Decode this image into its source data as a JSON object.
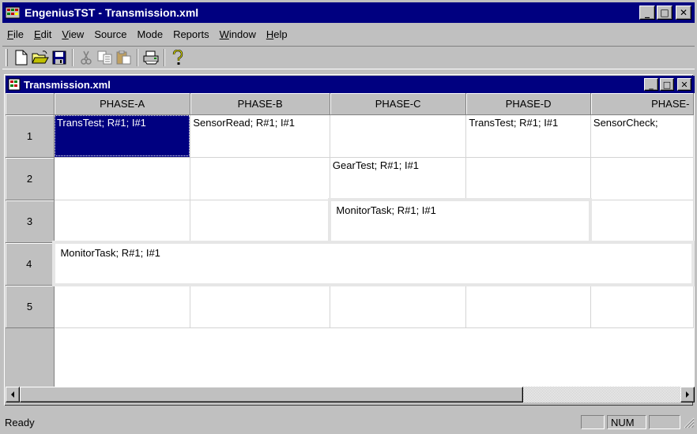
{
  "app": {
    "title": "EngeniusTST - Transmission.xml"
  },
  "menu": [
    {
      "pre": "",
      "key": "F",
      "post": "ile"
    },
    {
      "pre": "",
      "key": "E",
      "post": "dit"
    },
    {
      "pre": "",
      "key": "V",
      "post": "iew"
    },
    {
      "pre": "Source",
      "key": "",
      "post": ""
    },
    {
      "pre": "Mode",
      "key": "",
      "post": ""
    },
    {
      "pre": "Reports",
      "key": "",
      "post": ""
    },
    {
      "pre": "",
      "key": "W",
      "post": "indow"
    },
    {
      "pre": "",
      "key": "H",
      "post": "elp"
    }
  ],
  "window_buttons": {
    "minimize": "_",
    "maximize": "□",
    "close": "✕"
  },
  "document": {
    "title": "Transmission.xml"
  },
  "grid": {
    "columns": [
      "PHASE-A",
      "PHASE-B",
      "PHASE-C",
      "PHASE-D",
      "PHASE-"
    ],
    "rows": [
      {
        "label": "1",
        "cells": [
          "TransTest; R#1; I#1",
          "SensorRead; R#1; I#1",
          "",
          "TransTest; R#1; I#1",
          "SensorCheck;"
        ]
      },
      {
        "label": "2",
        "cells": [
          "",
          "",
          "GearTest; R#1; I#1",
          "",
          ""
        ]
      },
      {
        "label": "3",
        "cells": [
          "",
          "",
          "MonitorTask; R#1; I#1",
          "",
          ""
        ]
      },
      {
        "label": "4",
        "cells": [
          "MonitorTask; R#1; I#1"
        ]
      },
      {
        "label": "5",
        "cells": [
          "",
          "",
          "",
          "",
          ""
        ]
      }
    ]
  },
  "status": {
    "text": "Ready",
    "num": "NUM"
  },
  "colors": {
    "titlebar": "#000080",
    "face": "#c0c0c0",
    "selection": "#000080"
  }
}
